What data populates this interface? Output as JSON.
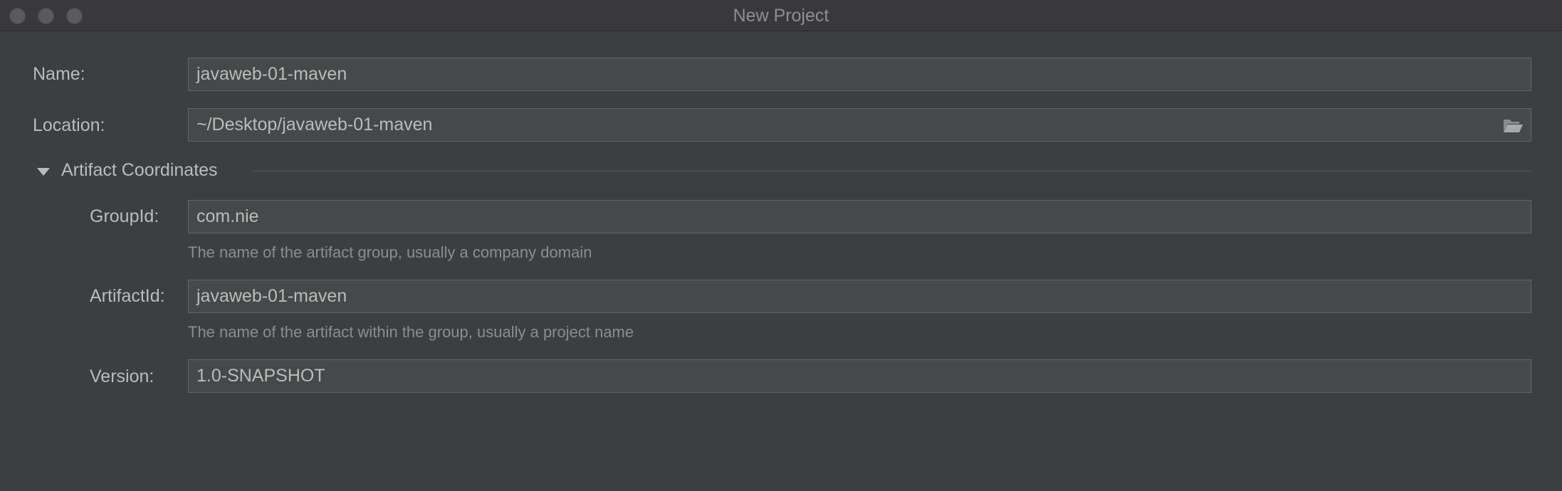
{
  "window": {
    "title": "New Project"
  },
  "form": {
    "name_label": "Name:",
    "name_value": "javaweb-01-maven",
    "location_label": "Location:",
    "location_value": "~/Desktop/javaweb-01-maven",
    "location_icon": "folder-open-icon"
  },
  "artifact": {
    "section_title": "Artifact Coordinates",
    "groupid_label": "GroupId:",
    "groupid_value": "com.nie",
    "groupid_hint": "The name of the artifact group, usually a company domain",
    "artifactid_label": "ArtifactId:",
    "artifactid_value": "javaweb-01-maven",
    "artifactid_hint": "The name of the artifact within the group, usually a project name",
    "version_label": "Version:",
    "version_value": "1.0-SNAPSHOT"
  },
  "colors": {
    "background": "#3c3f41",
    "field_background": "#45494a",
    "field_border": "#646464",
    "text": "#bbbbbb",
    "hint_text": "#8c8c8c"
  }
}
